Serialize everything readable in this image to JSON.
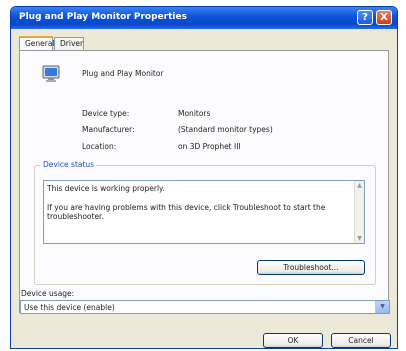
{
  "window": {
    "title": "Plug and Play Monitor Properties",
    "help_glyph": "?",
    "close_glyph": "X"
  },
  "tabs": [
    {
      "label": "General",
      "active": true
    },
    {
      "label": "Driver",
      "active": false
    }
  ],
  "device": {
    "name": "Plug and Play Monitor",
    "properties": [
      {
        "label": "Device type:",
        "value": "Monitors"
      },
      {
        "label": "Manufacturer:",
        "value": "(Standard monitor types)"
      },
      {
        "label": "Location:",
        "value": "on 3D Prophet III"
      }
    ]
  },
  "status": {
    "group_label": "Device status",
    "line1": "This device is working properly.",
    "line2": "If you are having problems with this device, click Troubleshoot to start the troubleshooter.",
    "troubleshoot_label": "Troubleshoot..."
  },
  "usage": {
    "label": "Device usage:",
    "selected": "Use this device (enable)"
  },
  "footer": {
    "ok_label": "OK",
    "cancel_label": "Cancel"
  }
}
